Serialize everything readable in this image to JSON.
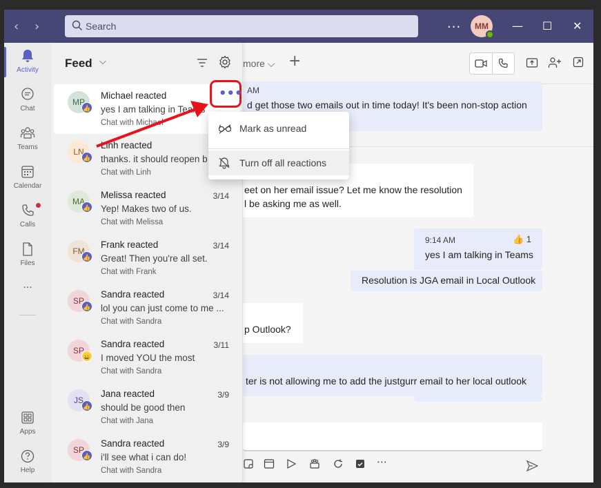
{
  "titlebar": {
    "search_placeholder": "Search",
    "user_initials": "MM",
    "more_label": "..."
  },
  "rail": {
    "items": [
      {
        "label": "Activity",
        "icon": "bell-icon"
      },
      {
        "label": "Chat",
        "icon": "chat-icon"
      },
      {
        "label": "Teams",
        "icon": "teams-icon"
      },
      {
        "label": "Calendar",
        "icon": "calendar-icon"
      },
      {
        "label": "Calls",
        "icon": "phone-icon"
      },
      {
        "label": "Files",
        "icon": "file-icon"
      },
      {
        "label": "...",
        "icon": "more-icon"
      },
      {
        "label": "Apps",
        "icon": "apps-icon"
      },
      {
        "label": "Help",
        "icon": "help-icon"
      }
    ]
  },
  "feed": {
    "title": "Feed",
    "items": [
      {
        "initials": "MP",
        "title": "Michael reacted",
        "date": "",
        "preview": "yes I am talking in Teams",
        "sub": "Chat with Michael",
        "badge": "👍",
        "av_bg": "#d4e3d9",
        "av_fg": "#3f6b4f"
      },
      {
        "initials": "LN",
        "title": "Linh reacted",
        "date": "",
        "preview": "thanks. it should reopen b",
        "sub": "Chat with Linh",
        "badge": "👍",
        "av_bg": "#fde8d4",
        "av_fg": "#8a5a2b"
      },
      {
        "initials": "MA",
        "title": "Melissa reacted",
        "date": "3/14",
        "preview": "Yep! Makes two of us.",
        "sub": "Chat with Melissa",
        "badge": "👍",
        "av_bg": "#dfe9d9",
        "av_fg": "#4b6b3b"
      },
      {
        "initials": "FM",
        "title": "Frank reacted",
        "date": "3/14",
        "preview": "Great! Then you're all set.",
        "sub": "Chat with Frank",
        "badge": "👍",
        "av_bg": "#efe3d6",
        "av_fg": "#7a5a3a"
      },
      {
        "initials": "SP",
        "title": "Sandra reacted",
        "date": "3/14",
        "preview": "lol you can just come to me ...",
        "sub": "Chat with Sandra",
        "badge": "👍",
        "av_bg": "#f1d5d8",
        "av_fg": "#8a3040"
      },
      {
        "initials": "SP",
        "title": "Sandra reacted",
        "date": "3/11",
        "preview": "I moved YOU the most",
        "sub": "Chat with Sandra",
        "badge": "😄",
        "av_bg": "#f1d5d8",
        "av_fg": "#8a3040"
      },
      {
        "initials": "JS",
        "title": "Jana reacted",
        "date": "3/9",
        "preview": "should be good then",
        "sub": "Chat with Jana",
        "badge": "👍",
        "av_bg": "#e3e0f3",
        "av_fg": "#4b4585"
      },
      {
        "initials": "SP",
        "title": "Sandra reacted",
        "date": "3/9",
        "preview": "i'll see what i can do!",
        "sub": "Chat with Sandra",
        "badge": "👍",
        "av_bg": "#f1d5d8",
        "av_fg": "#8a3040"
      }
    ]
  },
  "context_menu": {
    "items": [
      {
        "label": "Mark as unread",
        "icon": "glasses-icon"
      },
      {
        "label": "Turn off all reactions",
        "icon": "bell-off-icon"
      }
    ],
    "more_button": "•••"
  },
  "chat": {
    "more_tab": "more",
    "messages": {
      "m1_time": "AM",
      "m1_text": "d get those two emails out in time today! It's been non-stop action",
      "m2_text1": "eet on her email issue? Let me know the resolution",
      "m2_text2": "l be asking me as well.",
      "m3_time": "9:14 AM",
      "m3_reaction": "👍 1",
      "m3_text": "yes I am talking in Teams",
      "m4_text": "Resolution is JGA email in Local Outlook",
      "m5_text": "p Outlook?",
      "m6_text": "ter is not allowing me to add the justgurr email to her local outlook"
    }
  },
  "colors": {
    "brand": "#5b5fc7",
    "titlebar": "#464775",
    "highlight_box": "#e8121d"
  }
}
